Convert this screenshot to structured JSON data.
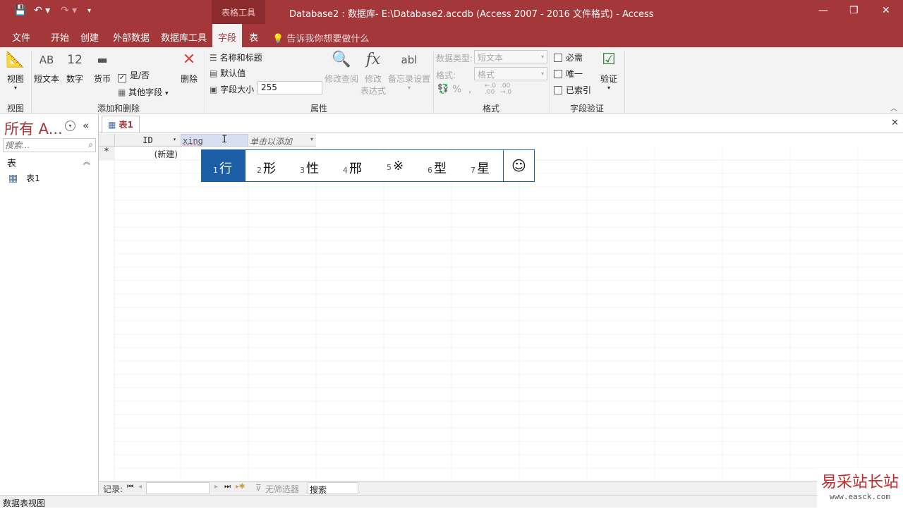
{
  "window": {
    "title": "Database2 : 数据库- E:\\Database2.accdb (Access 2007 - 2016 文件格式)  -  Access",
    "context_tab_group": "表格工具"
  },
  "tabs": [
    "文件",
    "开始",
    "创建",
    "外部数据",
    "数据库工具",
    "字段",
    "表"
  ],
  "active_tab": "字段",
  "tell_me": "告诉我你想要做什么",
  "ribbon": {
    "view_group": {
      "label": "视图",
      "button": "视图"
    },
    "add_delete_group": {
      "label": "添加和删除",
      "short_text": "短文本",
      "number": "数字",
      "currency": "货币",
      "yes_no": "是/否",
      "other_fields": "其他字段",
      "delete": "删除"
    },
    "properties_group": {
      "label": "属性",
      "name_caption": "名称和标题",
      "default_value": "默认值",
      "field_size": "字段大小",
      "field_size_value": "255",
      "modify_lookups": "修改查阅",
      "modify_expression_1": "修改",
      "modify_expression_2": "表达式",
      "memo_settings": "备忘录设置"
    },
    "format_group": {
      "label": "格式",
      "data_type_label": "数据类型:",
      "data_type_value": "短文本",
      "format_label": "格式:",
      "format_value": "格式"
    },
    "validation_group": {
      "label": "字段验证",
      "required": "必需",
      "unique": "唯一",
      "indexed": "已索引",
      "validation": "验证"
    }
  },
  "nav_pane": {
    "title": "所有 A...",
    "search_placeholder": "搜索...",
    "section": "表",
    "items": [
      "表1"
    ]
  },
  "document_tab": "表1",
  "datasheet": {
    "columns": [
      "ID",
      "xing",
      "单击以添加"
    ],
    "new_row_marker": "*",
    "new_row_value": "(新建)"
  },
  "ime": {
    "candidates": [
      {
        "num": "1",
        "char": "行"
      },
      {
        "num": "2",
        "char": "形"
      },
      {
        "num": "3",
        "char": "性"
      },
      {
        "num": "4",
        "char": "邢"
      },
      {
        "num": "5",
        "char": "※"
      },
      {
        "num": "6",
        "char": "型"
      },
      {
        "num": "7",
        "char": "星"
      }
    ],
    "emoji": "☺"
  },
  "record_bar": {
    "label": "记录:",
    "filter": "无筛选器",
    "search": "搜索"
  },
  "status": "数据表视图",
  "watermark": {
    "text": "易采站长站",
    "url": "www.easck.com"
  }
}
